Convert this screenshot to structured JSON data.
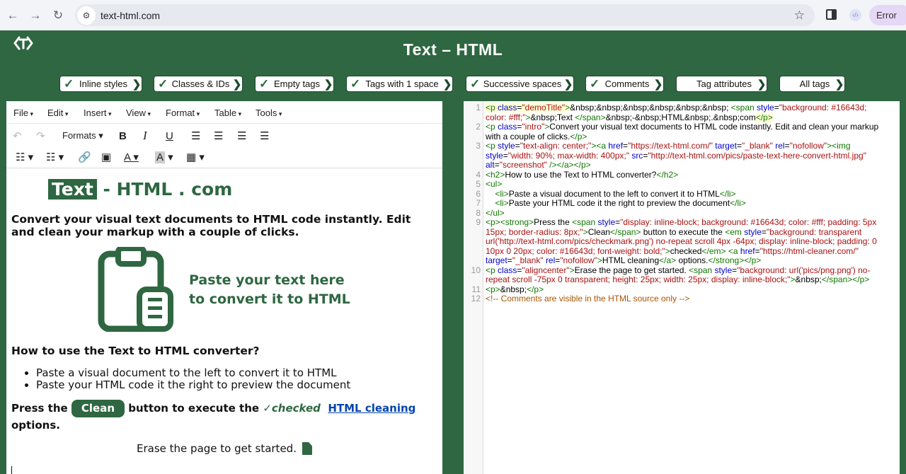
{
  "browser": {
    "url": "text-html.com",
    "error_label": "Error"
  },
  "site": {
    "title": "Text  –  HTML"
  },
  "options": [
    {
      "label": "Inline styles",
      "checked": true
    },
    {
      "label": "Classes & IDs",
      "checked": true
    },
    {
      "label": "Empty tags",
      "checked": true
    },
    {
      "label": "Tags with 1 space",
      "checked": true
    },
    {
      "label": "Successive spaces",
      "checked": true
    },
    {
      "label": "Comments",
      "checked": true
    },
    {
      "label": "Tag attributes",
      "checked": false
    },
    {
      "label": "All tags",
      "checked": false
    }
  ],
  "menubar": [
    "File",
    "Edit",
    "Insert",
    "View",
    "Format",
    "Table",
    "Tools"
  ],
  "toolbar": {
    "formats_label": "Formats ▾"
  },
  "document": {
    "title_highlight": "Text",
    "title_rest": " - HTML . com",
    "intro": "Convert your visual text documents to HTML code instantly. Edit and clean your markup with a couple of clicks.",
    "screenshot_line1": "Paste your text here",
    "screenshot_line2": "to convert it to HTML",
    "how_to_heading": "How to use the Text to HTML converter?",
    "list": [
      "Paste a visual document to the left to convert it to HTML",
      "Paste your HTML code it the right to preview the document"
    ],
    "press_text": "Press the ",
    "clean_label": "Clean",
    "press_text2": " button to execute the ",
    "checked_label": "checked",
    "link_label": "HTML cleaning",
    "options_text": "options.",
    "erase_text": "Erase the page to get started."
  },
  "code_lines": [
    "1",
    "2",
    "3",
    "4",
    "5",
    "6",
    "7",
    "8",
    "9",
    "10",
    "11",
    "12"
  ],
  "colors": {
    "brand_green": "#2e6741",
    "link_blue": "#0645ad"
  }
}
